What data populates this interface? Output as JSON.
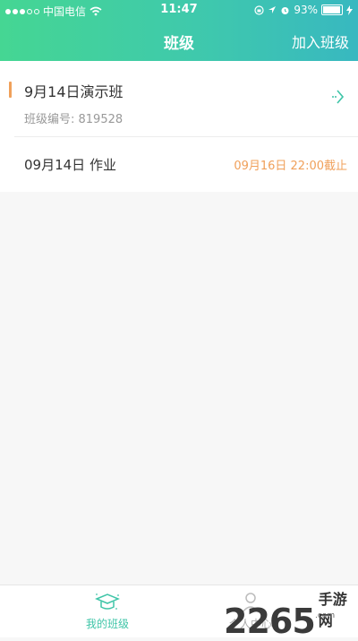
{
  "status_bar": {
    "carrier": "中国电信",
    "time": "11:47",
    "battery": "93%",
    "battery_level": 0.93
  },
  "nav": {
    "title": "班级",
    "action": "加入班级"
  },
  "class_card": {
    "name": "9月14日演示班",
    "code": "班级编号: 819528",
    "homework": {
      "title": "09月14日 作业",
      "deadline": "09月16日 22:00截止"
    }
  },
  "tabbar": {
    "tabs": [
      {
        "label": "我的班级",
        "active": true
      },
      {
        "label": "个人中心",
        "active": false
      }
    ]
  },
  "watermark": {
    "number": "2265",
    "text": "手游网",
    "url": ".com"
  },
  "colors": {
    "accent_green": "#3fc5a8",
    "accent_orange": "#f0a05a",
    "header_gradient_start": "#45d693",
    "header_gradient_end": "#38b8c0"
  },
  "icons": [
    "wifi-icon",
    "location-arrow-icon",
    "alarm-icon",
    "battery-icon",
    "chevron-right-icon",
    "graduation-cap-icon",
    "person-icon"
  ]
}
